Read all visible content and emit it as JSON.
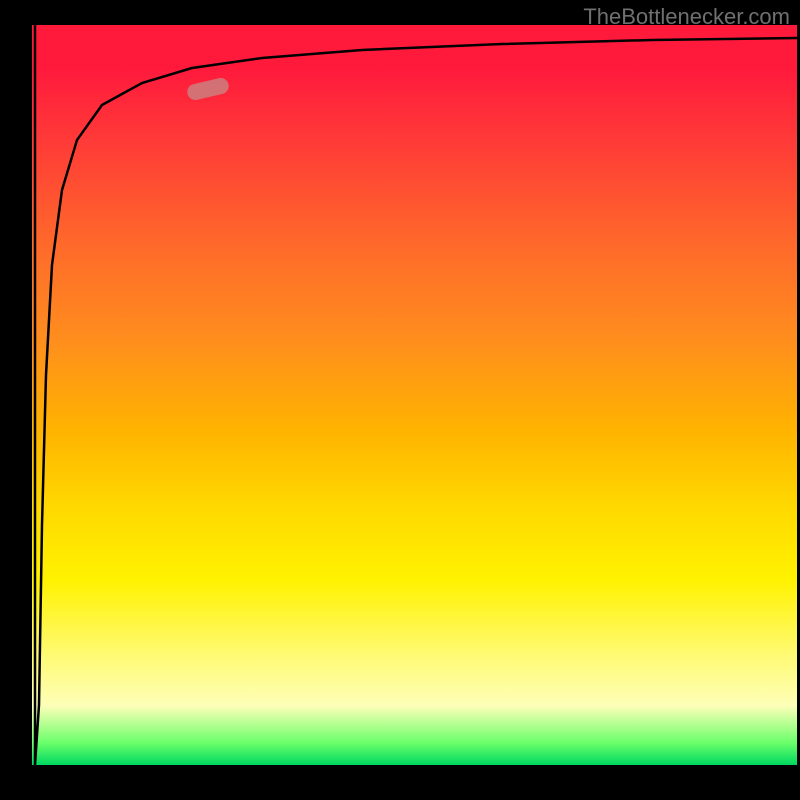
{
  "watermark": "TheBottlenecker.com",
  "chart_data": {
    "type": "line",
    "title": "",
    "xlabel": "",
    "ylabel": "",
    "xlim": [
      0,
      100
    ],
    "ylim": [
      0,
      100
    ],
    "series": [
      {
        "name": "bottleneck-curve",
        "x": [
          0,
          1,
          1.5,
          2,
          3,
          5,
          8,
          12,
          18,
          25,
          35,
          50,
          70,
          100
        ],
        "y": [
          100,
          30,
          8,
          40,
          62,
          76,
          83,
          87,
          90,
          92,
          94,
          95,
          96,
          97
        ]
      }
    ],
    "marker": {
      "x": 22,
      "y": 89,
      "color": "#c07a7a"
    },
    "gradient_stops": [
      {
        "offset": 0,
        "color": "#ff1a3c"
      },
      {
        "offset": 50,
        "color": "#ffb400"
      },
      {
        "offset": 80,
        "color": "#fff200"
      },
      {
        "offset": 100,
        "color": "#00d860"
      }
    ]
  }
}
